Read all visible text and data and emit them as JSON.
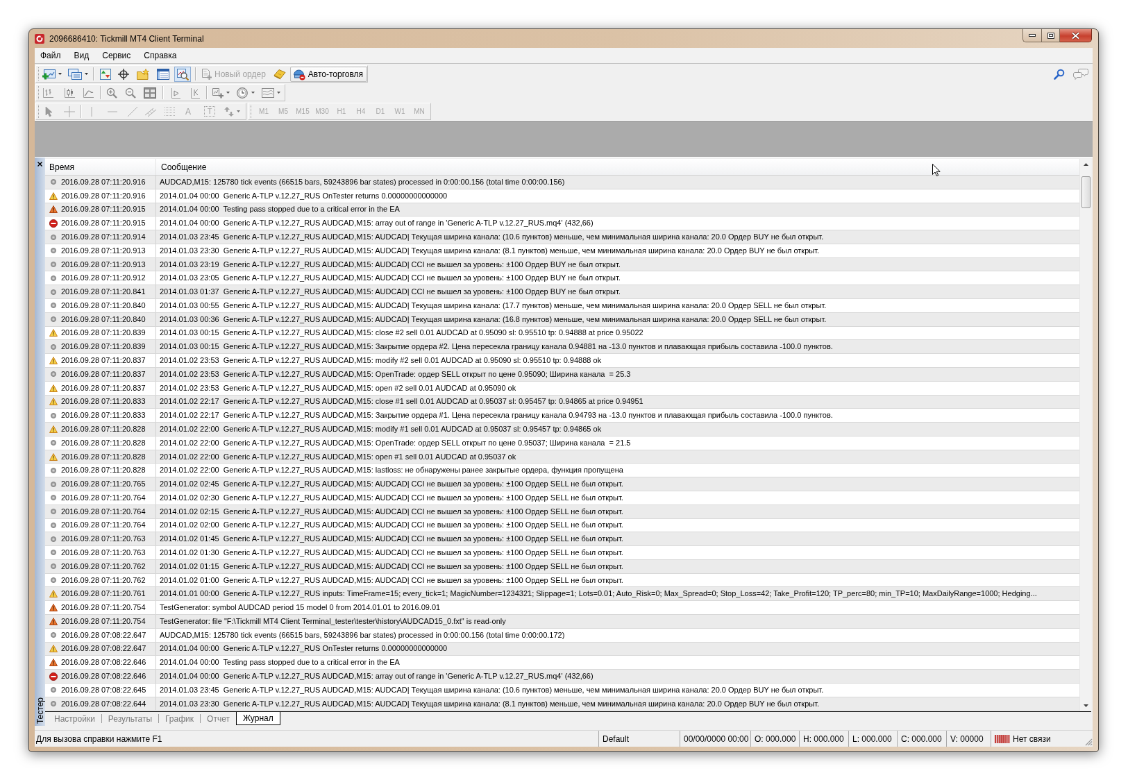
{
  "window": {
    "title": "2096686410: Tickmill MT4 Client Terminal"
  },
  "menu": [
    "Файл",
    "Вид",
    "Сервис",
    "Справка"
  ],
  "toolbar": {
    "tester_button": {
      "pressed": true
    },
    "new_order": {
      "label": "Новый ордер",
      "disabled": true
    },
    "auto_trading": {
      "label": "Авто-торговля",
      "on": false
    }
  },
  "drawing_tools": {
    "text_tool": "A",
    "text_label_tool": "T"
  },
  "periods": [
    {
      "label": "M1",
      "disabled": true
    },
    {
      "label": "M5",
      "disabled": true
    },
    {
      "label": "M15",
      "disabled": true
    },
    {
      "label": "M30",
      "disabled": true
    },
    {
      "label": "H1",
      "disabled": true
    },
    {
      "label": "H4",
      "disabled": true
    },
    {
      "label": "D1",
      "disabled": true
    },
    {
      "label": "W1",
      "disabled": true
    },
    {
      "label": "MN",
      "disabled": true
    }
  ],
  "terminal": {
    "side_label": "Тестер",
    "columns": [
      "Время",
      "Сообщение"
    ],
    "rows": [
      {
        "kind": "info",
        "time": "2016.09.28 07:11:20.916",
        "message": "AUDCAD,M15: 125780 tick events (66515 bars, 59243896 bar states) processed in 0:00:00.156 (total time 0:00:00.156)"
      },
      {
        "kind": "warning",
        "time": "2016.09.28 07:11:20.916",
        "message": "2014.01.04 00:00  Generic A-TLP v.12.27_RUS OnTester returns 0.00000000000000"
      },
      {
        "kind": "alert",
        "time": "2016.09.28 07:11:20.915",
        "message": "2014.01.04 00:00  Testing pass stopped due to a critical error in the EA"
      },
      {
        "kind": "error",
        "time": "2016.09.28 07:11:20.915",
        "message": "2014.01.04 00:00  Generic A-TLP v.12.27_RUS AUDCAD,M15: array out of range in 'Generic A-TLP v.12.27_RUS.mq4' (432,66)"
      },
      {
        "kind": "info",
        "time": "2016.09.28 07:11:20.914",
        "message": "2014.01.03 23:45  Generic A-TLP v.12.27_RUS AUDCAD,M15: AUDCAD| Текущая ширина канала: (10.6 пунктов) меньше, чем минимальная ширина канала: 20.0 Ордер BUY не был открыт."
      },
      {
        "kind": "info",
        "time": "2016.09.28 07:11:20.913",
        "message": "2014.01.03 23:30  Generic A-TLP v.12.27_RUS AUDCAD,M15: AUDCAD| Текущая ширина канала: (8.1 пунктов) меньше, чем минимальная ширина канала: 20.0 Ордер BUY не был открыт."
      },
      {
        "kind": "info",
        "time": "2016.09.28 07:11:20.913",
        "message": "2014.01.03 23:19  Generic A-TLP v.12.27_RUS AUDCAD,M15: AUDCAD| CCI не вышел за уровень: ±100 Ордер BUY не был открыт."
      },
      {
        "kind": "info",
        "time": "2016.09.28 07:11:20.912",
        "message": "2014.01.03 23:05  Generic A-TLP v.12.27_RUS AUDCAD,M15: AUDCAD| CCI не вышел за уровень: ±100 Ордер BUY не был открыт."
      },
      {
        "kind": "info",
        "time": "2016.09.28 07:11:20.841",
        "message": "2014.01.03 01:37  Generic A-TLP v.12.27_RUS AUDCAD,M15: AUDCAD| CCI не вышел за уровень: ±100 Ордер BUY не был открыт."
      },
      {
        "kind": "info",
        "time": "2016.09.28 07:11:20.840",
        "message": "2014.01.03 00:55  Generic A-TLP v.12.27_RUS AUDCAD,M15: AUDCAD| Текущая ширина канала: (17.7 пунктов) меньше, чем минимальная ширина канала: 20.0 Ордер SELL не был открыт."
      },
      {
        "kind": "info",
        "time": "2016.09.28 07:11:20.840",
        "message": "2014.01.03 00:36  Generic A-TLP v.12.27_RUS AUDCAD,M15: AUDCAD| Текущая ширина канала: (16.8 пунктов) меньше, чем минимальная ширина канала: 20.0 Ордер SELL не был открыт."
      },
      {
        "kind": "warning",
        "time": "2016.09.28 07:11:20.839",
        "message": "2014.01.03 00:15  Generic A-TLP v.12.27_RUS AUDCAD,M15: close #2 sell 0.01 AUDCAD at 0.95090 sl: 0.95510 tp: 0.94888 at price 0.95022"
      },
      {
        "kind": "info",
        "time": "2016.09.28 07:11:20.839",
        "message": "2014.01.03 00:15  Generic A-TLP v.12.27_RUS AUDCAD,M15: Закрытие ордера #2. Цена пересекла границу канала 0.94881 на -13.0 пунктов и плавающая прибыль составила -100.0 пунктов."
      },
      {
        "kind": "warning",
        "time": "2016.09.28 07:11:20.837",
        "message": "2014.01.02 23:53  Generic A-TLP v.12.27_RUS AUDCAD,M15: modify #2 sell 0.01 AUDCAD at 0.95090 sl: 0.95510 tp: 0.94888 ok"
      },
      {
        "kind": "info",
        "time": "2016.09.28 07:11:20.837",
        "message": "2014.01.02 23:53  Generic A-TLP v.12.27_RUS AUDCAD,M15: OpenTrade: ордер SELL открыт по цене 0.95090; Ширина канала  = 25.3"
      },
      {
        "kind": "warning",
        "time": "2016.09.28 07:11:20.837",
        "message": "2014.01.02 23:53  Generic A-TLP v.12.27_RUS AUDCAD,M15: open #2 sell 0.01 AUDCAD at 0.95090 ok"
      },
      {
        "kind": "warning",
        "time": "2016.09.28 07:11:20.833",
        "message": "2014.01.02 22:17  Generic A-TLP v.12.27_RUS AUDCAD,M15: close #1 sell 0.01 AUDCAD at 0.95037 sl: 0.95457 tp: 0.94865 at price 0.94951"
      },
      {
        "kind": "info",
        "time": "2016.09.28 07:11:20.833",
        "message": "2014.01.02 22:17  Generic A-TLP v.12.27_RUS AUDCAD,M15: Закрытие ордера #1. Цена пересекла границу канала 0.94793 на -13.0 пунктов и плавающая прибыль составила -100.0 пунктов."
      },
      {
        "kind": "warning",
        "time": "2016.09.28 07:11:20.828",
        "message": "2014.01.02 22:00  Generic A-TLP v.12.27_RUS AUDCAD,M15: modify #1 sell 0.01 AUDCAD at 0.95037 sl: 0.95457 tp: 0.94865 ok"
      },
      {
        "kind": "info",
        "time": "2016.09.28 07:11:20.828",
        "message": "2014.01.02 22:00  Generic A-TLP v.12.27_RUS AUDCAD,M15: OpenTrade: ордер SELL открыт по цене 0.95037; Ширина канала  = 21.5"
      },
      {
        "kind": "warning",
        "time": "2016.09.28 07:11:20.828",
        "message": "2014.01.02 22:00  Generic A-TLP v.12.27_RUS AUDCAD,M15: open #1 sell 0.01 AUDCAD at 0.95037 ok"
      },
      {
        "kind": "info",
        "time": "2016.09.28 07:11:20.828",
        "message": "2014.01.02 22:00  Generic A-TLP v.12.27_RUS AUDCAD,M15: lastloss: не обнаружены ранее закрытые ордера, функция пропущена"
      },
      {
        "kind": "info",
        "time": "2016.09.28 07:11:20.765",
        "message": "2014.01.02 02:45  Generic A-TLP v.12.27_RUS AUDCAD,M15: AUDCAD| CCI не вышел за уровень: ±100 Ордер SELL не был открыт."
      },
      {
        "kind": "info",
        "time": "2016.09.28 07:11:20.764",
        "message": "2014.01.02 02:30  Generic A-TLP v.12.27_RUS AUDCAD,M15: AUDCAD| CCI не вышел за уровень: ±100 Ордер SELL не был открыт."
      },
      {
        "kind": "info",
        "time": "2016.09.28 07:11:20.764",
        "message": "2014.01.02 02:15  Generic A-TLP v.12.27_RUS AUDCAD,M15: AUDCAD| CCI не вышел за уровень: ±100 Ордер SELL не был открыт."
      },
      {
        "kind": "info",
        "time": "2016.09.28 07:11:20.764",
        "message": "2014.01.02 02:00  Generic A-TLP v.12.27_RUS AUDCAD,M15: AUDCAD| CCI не вышел за уровень: ±100 Ордер SELL не был открыт."
      },
      {
        "kind": "info",
        "time": "2016.09.28 07:11:20.763",
        "message": "2014.01.02 01:45  Generic A-TLP v.12.27_RUS AUDCAD,M15: AUDCAD| CCI не вышел за уровень: ±100 Ордер SELL не был открыт."
      },
      {
        "kind": "info",
        "time": "2016.09.28 07:11:20.763",
        "message": "2014.01.02 01:30  Generic A-TLP v.12.27_RUS AUDCAD,M15: AUDCAD| CCI не вышел за уровень: ±100 Ордер SELL не был открыт."
      },
      {
        "kind": "info",
        "time": "2016.09.28 07:11:20.762",
        "message": "2014.01.02 01:15  Generic A-TLP v.12.27_RUS AUDCAD,M15: AUDCAD| CCI не вышел за уровень: ±100 Ордер SELL не был открыт."
      },
      {
        "kind": "info",
        "time": "2016.09.28 07:11:20.762",
        "message": "2014.01.02 01:00  Generic A-TLP v.12.27_RUS AUDCAD,M15: AUDCAD| CCI не вышел за уровень: ±100 Ордер SELL не был открыт."
      },
      {
        "kind": "warning",
        "time": "2016.09.28 07:11:20.761",
        "message": "2014.01.01 00:00  Generic A-TLP v.12.27_RUS inputs: TimeFrame=15; every_tick=1; MagicNumber=1234321; Slippage=1; Lots=0.01; Auto_Risk=0; Max_Spread=0; Stop_Loss=42; Take_Profit=120; TP_perc=80; min_TP=10; MaxDailyRange=1000; Hedging..."
      },
      {
        "kind": "alert",
        "time": "2016.09.28 07:11:20.754",
        "message": "TestGenerator: symbol AUDCAD period 15 model 0 from 2014.01.01 to 2016.09.01"
      },
      {
        "kind": "alert",
        "time": "2016.09.28 07:11:20.754",
        "message": "TestGenerator: file \"F:\\Tickmill MT4 Client Terminal_tester\\tester\\history\\AUDCAD15_0.fxt\" is read-only"
      },
      {
        "kind": "info",
        "time": "2016.09.28 07:08:22.647",
        "message": "AUDCAD,M15: 125780 tick events (66515 bars, 59243896 bar states) processed in 0:00:00.156 (total time 0:00:00.172)"
      },
      {
        "kind": "warning",
        "time": "2016.09.28 07:08:22.647",
        "message": "2014.01.04 00:00  Generic A-TLP v.12.27_RUS OnTester returns 0.00000000000000"
      },
      {
        "kind": "alert",
        "time": "2016.09.28 07:08:22.646",
        "message": "2014.01.04 00:00  Testing pass stopped due to a critical error in the EA"
      },
      {
        "kind": "error",
        "time": "2016.09.28 07:08:22.646",
        "message": "2014.01.04 00:00  Generic A-TLP v.12.27_RUS AUDCAD,M15: array out of range in 'Generic A-TLP v.12.27_RUS.mq4' (432,66)"
      },
      {
        "kind": "info",
        "time": "2016.09.28 07:08:22.645",
        "message": "2014.01.03 23:45  Generic A-TLP v.12.27_RUS AUDCAD,M15: AUDCAD| Текущая ширина канала: (10.6 пунктов) меньше, чем минимальная ширина канала: 20.0 Ордер BUY не был открыт."
      },
      {
        "kind": "info",
        "time": "2016.09.28 07:08:22.644",
        "message": "2014.01.03 23:30  Generic A-TLP v.12.27_RUS AUDCAD,M15: AUDCAD| Текущая ширина канала: (8.1 пунктов) меньше, чем минимальная ширина канала: 20.0 Ордер BUY не был открыт."
      }
    ],
    "tabs": [
      {
        "label": "Настройки",
        "selected": false
      },
      {
        "label": "Результаты",
        "selected": false
      },
      {
        "label": "График",
        "selected": false
      },
      {
        "label": "Отчет",
        "selected": false
      },
      {
        "label": "Журнал",
        "selected": true
      }
    ]
  },
  "status_bar": {
    "hint": "Для вызова справки нажмите F1",
    "profile": "Default",
    "datetime": "00/00/0000 00:00",
    "open": "O: 000.000",
    "high": "H: 000.000",
    "low": "L: 000.000",
    "close": "C: 000.000",
    "volume": "V: 00000",
    "connection": "Нет связи",
    "connected": false
  }
}
